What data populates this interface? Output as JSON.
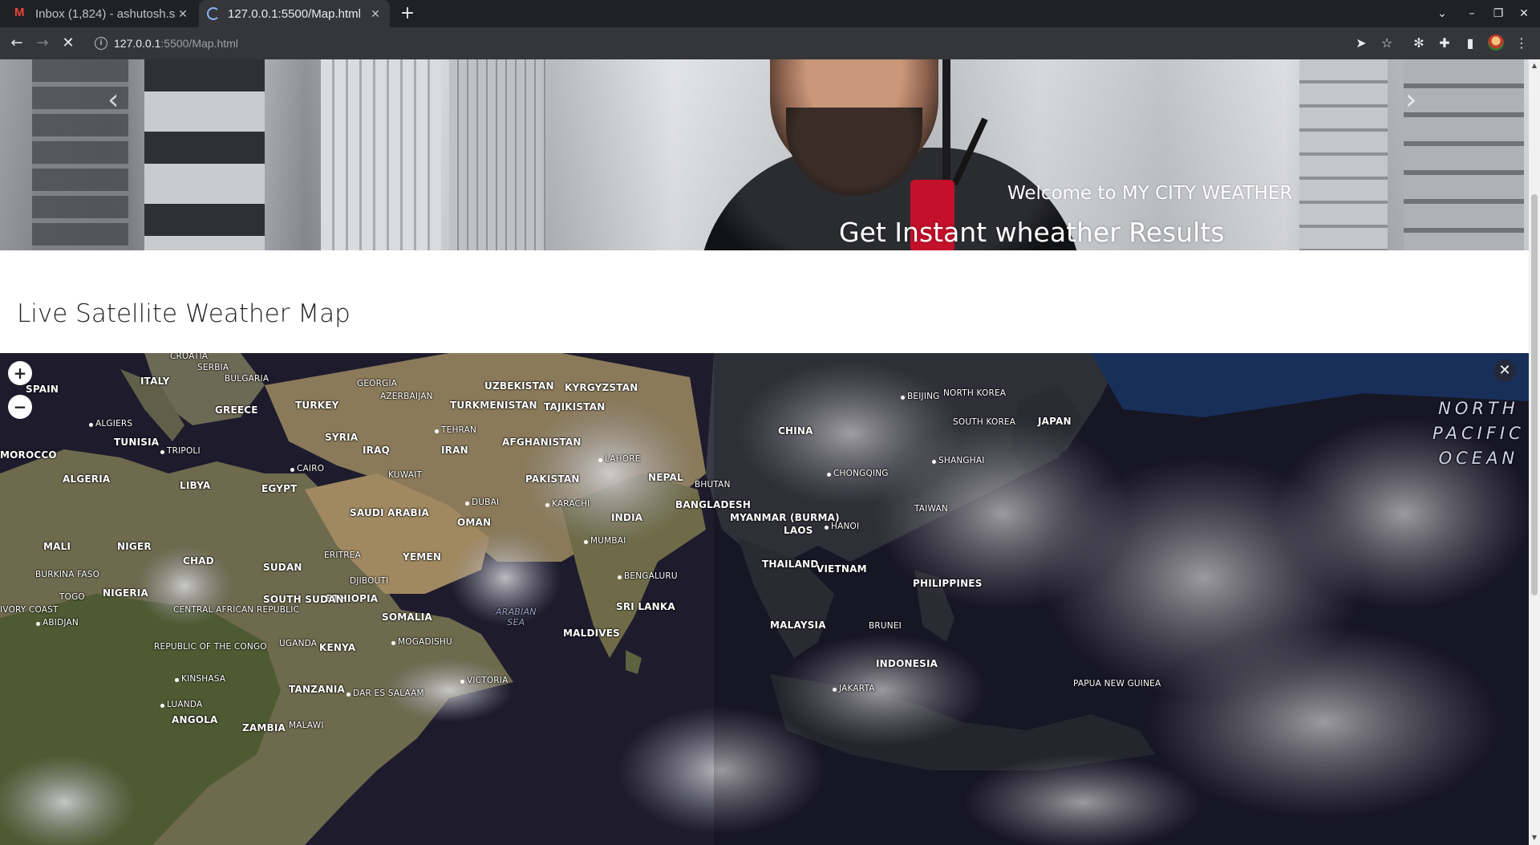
{
  "browser": {
    "tabs": [
      {
        "title": "Inbox (1,824) - ashutosh.s",
        "icon": "gmail-icon"
      },
      {
        "title": "127.0.0.1:5500/Map.html",
        "icon": "loading-spinner-icon"
      }
    ],
    "url_host": "127.0.0.1",
    "url_rest": ":5500/Map.html"
  },
  "hero": {
    "subtitle": "Welcome to MY CITY WEATHER",
    "title": "Get Instant wheather Results"
  },
  "section": {
    "title": "Live Satellite Weather Map"
  },
  "map": {
    "zoom_in_label": "+",
    "zoom_out_label": "−",
    "close_label": "✕",
    "ocean_label": "NORTH PACIFIC OCEAN",
    "sea_label": "ARABIAN SEA",
    "countries": [
      "CROATIA",
      "SERBIA",
      "ITALY",
      "BULGARIA",
      "SPAIN",
      "GREECE",
      "GEORGIA",
      "AZERBAIJAN",
      "UZBEKISTAN",
      "KYRGYZSTAN",
      "TURKMENISTAN",
      "TAJIKISTAN",
      "TURKEY",
      "TUNISIA",
      "SYRIA",
      "MOROCCO",
      "IRAQ",
      "IRAN",
      "AFGHANISTAN",
      "ALGERIA",
      "LIBYA",
      "EGYPT",
      "KUWAIT",
      "PAKISTAN",
      "NEPAL",
      "BHUTAN",
      "SAUDI ARABIA",
      "BANGLADESH",
      "INDIA",
      "OMAN",
      "MALI",
      "NIGER",
      "CHAD",
      "SUDAN",
      "ERITREA",
      "YEMEN",
      "BURKINA FASO",
      "DJIBOUTI",
      "NIGERIA",
      "ETHIOPIA",
      "TOGO",
      "SOUTH SUDAN",
      "CENTRAL AFRICAN REPUBLIC",
      "IVORY COAST",
      "SOMALIA",
      "SRI LANKA",
      "UGANDA",
      "KENYA",
      "REPUBLIC OF THE CONGO",
      "MALDIVES",
      "TANZANIA",
      "ANGOLA",
      "ZAMBIA",
      "MALAWI",
      "CHINA",
      "NORTH KOREA",
      "SOUTH KOREA",
      "JAPAN",
      "TAIWAN",
      "MYANMAR (BURMA)",
      "LAOS",
      "THAILAND",
      "VIETNAM",
      "PHILIPPINES",
      "MALAYSIA",
      "BRUNEI",
      "INDONESIA",
      "PAPUA NEW GUINEA"
    ],
    "cities": [
      "ALGIERS",
      "TRIPOLI",
      "TEHRAN",
      "CAIRO",
      "LAHORE",
      "DUBAI",
      "KARACHI",
      "MUMBAI",
      "BENGALURU",
      "ABIDJAN",
      "MOGADISHU",
      "VICTORIA",
      "KINSHASA",
      "DAR ES SALAAM",
      "LUANDA",
      "BEIJING",
      "SHANGHAI",
      "CHONGQING",
      "HANOI",
      "JAKARTA"
    ]
  }
}
